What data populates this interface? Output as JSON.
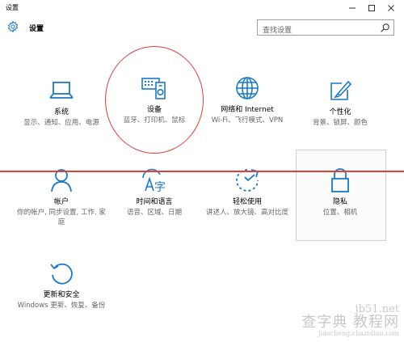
{
  "window": {
    "title": "设置"
  },
  "header": {
    "app_title": "设置"
  },
  "search": {
    "placeholder": "查找设置"
  },
  "tiles": [
    {
      "name": "系统",
      "desc": "显示、通知、应用、电源",
      "icon": "laptop-icon"
    },
    {
      "name": "设备",
      "desc": "蓝牙、打印机、鼠标",
      "icon": "devices-icon"
    },
    {
      "name": "网络和 Internet",
      "desc": "Wi-Fi、飞行模式、VPN",
      "icon": "globe-icon"
    },
    {
      "name": "个性化",
      "desc": "背景、锁屏、颜色",
      "icon": "paint-icon"
    },
    {
      "name": "帐户",
      "desc": "你的帐户, 同步设置, 工作, 家庭",
      "icon": "person-icon"
    },
    {
      "name": "时间和语言",
      "desc": "语音、区域、日期",
      "icon": "time-language-icon"
    },
    {
      "name": "轻松使用",
      "desc": "讲述人、放大镜、高对比度",
      "icon": "ease-of-access-icon"
    },
    {
      "name": "隐私",
      "desc": "位置、相机",
      "icon": "lock-icon"
    },
    {
      "name": "更新和安全",
      "desc": "Windows 更新、恢复、备份",
      "icon": "update-icon"
    }
  ],
  "watermark": {
    "line1": "jb51.net",
    "line2": "查字典 教程网",
    "line3": "jiaocheng.chazidian.com"
  },
  "colors": {
    "accent": "#1979ca",
    "annotation": "#e0403a"
  }
}
